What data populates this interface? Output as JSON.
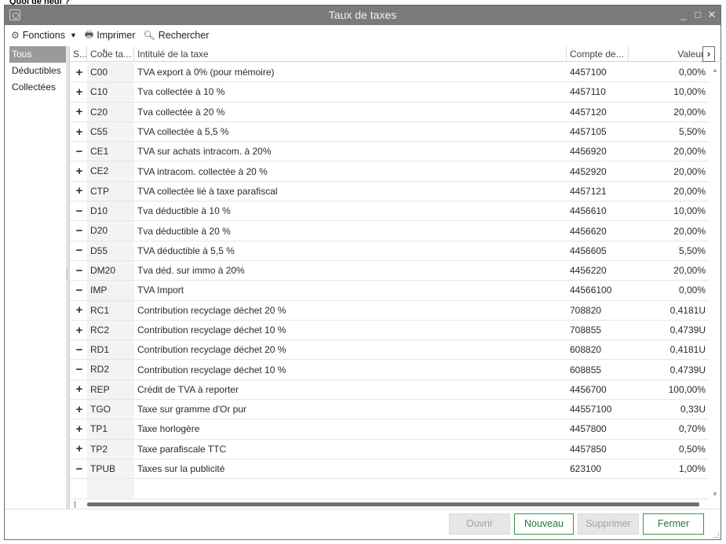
{
  "page_caption": "Quoi de neuf ?",
  "window": {
    "title": "Taux de taxes",
    "controls": {
      "minimize": "_",
      "maximize": "□",
      "close": "✕"
    }
  },
  "toolbar": {
    "fonctions": "Fonctions",
    "imprimer": "Imprimer",
    "rechercher": "Rechercher"
  },
  "sidebar": {
    "items": [
      {
        "label": "Tous",
        "selected": true
      },
      {
        "label": "Déductibles",
        "selected": false
      },
      {
        "label": "Collectées",
        "selected": false
      }
    ]
  },
  "grid": {
    "columns": [
      "S...",
      "Code ta...",
      "Intitulé de la taxe",
      "Compte de...",
      "Valeur"
    ],
    "rows": [
      {
        "sign": "+",
        "code": "C00",
        "label": "TVA export à 0% (pour mémoire)",
        "compte": "4457100",
        "valeur": "0,00%"
      },
      {
        "sign": "+",
        "code": "C10",
        "label": "Tva collectée à 10 %",
        "compte": "4457110",
        "valeur": "10,00%"
      },
      {
        "sign": "+",
        "code": "C20",
        "label": "Tva collectée à 20 %",
        "compte": "4457120",
        "valeur": "20,00%"
      },
      {
        "sign": "+",
        "code": "C55",
        "label": "TVA collectée à 5,5 %",
        "compte": "4457105",
        "valeur": "5,50%"
      },
      {
        "sign": "−",
        "code": "CE1",
        "label": "TVA sur achats intracom. à 20%",
        "compte": "4456920",
        "valeur": "20,00%"
      },
      {
        "sign": "+",
        "code": "CE2",
        "label": "TVA intracom. collectée à 20 %",
        "compte": "4452920",
        "valeur": "20,00%"
      },
      {
        "sign": "+",
        "code": "CTP",
        "label": "TVA collectée lié à taxe parafiscal",
        "compte": "4457121",
        "valeur": "20,00%"
      },
      {
        "sign": "−",
        "code": "D10",
        "label": "Tva déductible à 10 %",
        "compte": "4456610",
        "valeur": "10,00%"
      },
      {
        "sign": "−",
        "code": "D20",
        "label": "Tva déductible à 20 %",
        "compte": "4456620",
        "valeur": "20,00%"
      },
      {
        "sign": "−",
        "code": "D55",
        "label": "TVA déductible à 5,5 %",
        "compte": "4456605",
        "valeur": "5,50%"
      },
      {
        "sign": "−",
        "code": "DM20",
        "label": "Tva déd. sur immo à 20%",
        "compte": "4456220",
        "valeur": "20,00%"
      },
      {
        "sign": "−",
        "code": "IMP",
        "label": "TVA Import",
        "compte": "44566100",
        "valeur": "0,00%"
      },
      {
        "sign": "+",
        "code": "RC1",
        "label": "Contribution recyclage déchet 20 %",
        "compte": "708820",
        "valeur": "0,4181U"
      },
      {
        "sign": "+",
        "code": "RC2",
        "label": "Contribution recyclage déchet 10 %",
        "compte": "708855",
        "valeur": "0,4739U"
      },
      {
        "sign": "−",
        "code": "RD1",
        "label": "Contribution recyclage déchet 20 %",
        "compte": "608820",
        "valeur": "0,4181U"
      },
      {
        "sign": "−",
        "code": "RD2",
        "label": "Contribution recyclage déchet 10 %",
        "compte": "608855",
        "valeur": "0,4739U"
      },
      {
        "sign": "+",
        "code": "REP",
        "label": "Crédit de TVA à reporter",
        "compte": "4456700",
        "valeur": "100,00%"
      },
      {
        "sign": "+",
        "code": "TGO",
        "label": "Taxe sur gramme d'Or pur",
        "compte": "44557100",
        "valeur": "0,33U"
      },
      {
        "sign": "+",
        "code": "TP1",
        "label": "Taxe horlogère",
        "compte": "4457800",
        "valeur": "0,70%"
      },
      {
        "sign": "+",
        "code": "TP2",
        "label": "Taxe parafiscale TTC",
        "compte": "4457850",
        "valeur": "0,50%"
      },
      {
        "sign": "−",
        "code": "TPUB",
        "label": "Taxes sur la publicité",
        "compte": "623100",
        "valeur": "1,00%"
      }
    ]
  },
  "footer": {
    "ouvrir": "Ouvrir",
    "nouveau": "Nouveau",
    "supprimer": "Supprimer",
    "fermer": "Fermer"
  },
  "colors": {
    "titlebar": "#7a7a7a",
    "selected": "#9a9a9a",
    "accent": "#2e9a4b"
  }
}
